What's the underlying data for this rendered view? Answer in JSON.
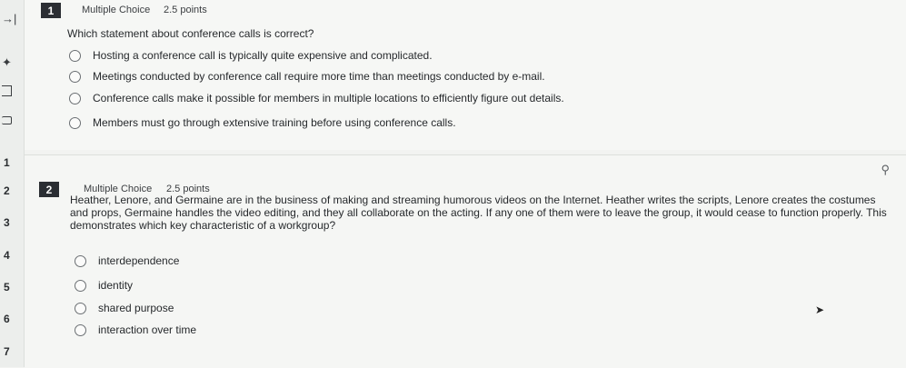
{
  "sidebar": {
    "nav_icon": "→|",
    "pin_icon": "✦",
    "numbers": [
      "1",
      "2",
      "3",
      "4",
      "5",
      "6",
      "7"
    ]
  },
  "q1": {
    "number": "1",
    "type": "Multiple Choice",
    "points": "2.5 points",
    "text": "Which statement about conference calls is correct?",
    "options": [
      "Hosting a conference call is typically quite expensive and complicated.",
      "Meetings conducted by conference call require more time than meetings conducted by e-mail.",
      "Conference calls make it possible for members in multiple locations to efficiently figure out details.",
      "Members must go through extensive training before using conference calls."
    ]
  },
  "q2": {
    "number": "2",
    "type": "Multiple Choice",
    "points": "2.5 points",
    "text": "Heather, Lenore, and Germaine are in the business of making and streaming humorous videos on the Internet. Heather writes the scripts, Lenore creates the costumes and props, Germaine handles the video editing, and they all collaborate on the acting. If any one of them were to leave the group, it would cease to function properly. This demonstrates which key characteristic of a workgroup?",
    "options": [
      "interdependence",
      "identity",
      "shared purpose",
      "interaction over time"
    ]
  }
}
